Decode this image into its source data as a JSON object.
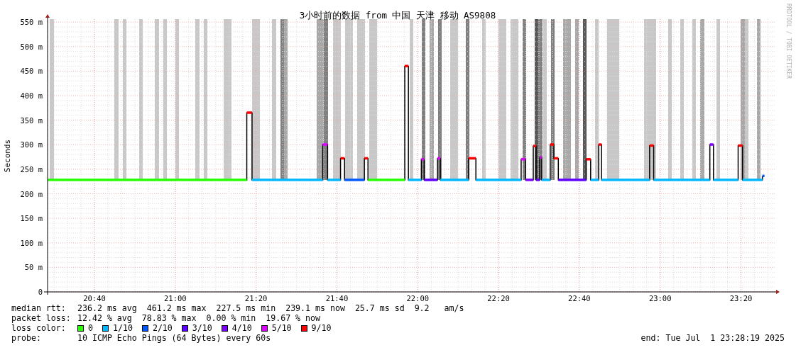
{
  "graph": {
    "title": "3小时前的数据 from 中国 天津 移动 AS9808",
    "side_text": "RRDTOOL / TOBI OETIKER",
    "chart_data": {
      "type": "line",
      "ylabel": "Seconds",
      "grid": true,
      "xlim": [
        1228.4,
        1408.7
      ],
      "ylim": [
        0,
        556
      ],
      "xticks": [
        {
          "value": 1240,
          "label": "20:40"
        },
        {
          "value": 1260,
          "label": "21:00"
        },
        {
          "value": 1280,
          "label": "21:20"
        },
        {
          "value": 1300,
          "label": "21:40"
        },
        {
          "value": 1320,
          "label": "22:00"
        },
        {
          "value": 1340,
          "label": "22:20"
        },
        {
          "value": 1360,
          "label": "22:40"
        },
        {
          "value": 1380,
          "label": "23:00"
        },
        {
          "value": 1400,
          "label": "23:20"
        }
      ],
      "yticks": [
        {
          "value": 0,
          "label": "0"
        },
        {
          "value": 50,
          "label": "50 m"
        },
        {
          "value": 100,
          "label": "100 m"
        },
        {
          "value": 150,
          "label": "150 m"
        },
        {
          "value": 200,
          "label": "200 m"
        },
        {
          "value": 250,
          "label": "250 m"
        },
        {
          "value": 300,
          "label": "300 m"
        },
        {
          "value": 350,
          "label": "350 m"
        },
        {
          "value": 400,
          "label": "400 m"
        },
        {
          "value": 450,
          "label": "450 m"
        },
        {
          "value": 500,
          "label": "500 m"
        },
        {
          "value": 550,
          "label": "550 m"
        }
      ],
      "x": [
        1228.5,
        1277.7,
        1277.7,
        1279.0,
        1279.0,
        1296.5,
        1296.5,
        1297.7,
        1297.7,
        1300.9,
        1300.9,
        1301.9,
        1301.9,
        1306.8,
        1306.8,
        1307.7,
        1307.7,
        1316.8,
        1316.8,
        1317.7,
        1317.7,
        1320.9,
        1320.9,
        1321.6,
        1321.6,
        1324.9,
        1324.9,
        1325.6,
        1325.6,
        1332.6,
        1332.6,
        1334.4,
        1334.4,
        1345.6,
        1345.6,
        1346.7,
        1346.7,
        1348.6,
        1348.6,
        1349.3,
        1349.3,
        1350.2,
        1350.2,
        1350.7,
        1350.7,
        1352.8,
        1352.8,
        1353.7,
        1353.7,
        1354.8,
        1354.8,
        1361.7,
        1361.7,
        1362.8,
        1362.8,
        1364.8,
        1364.8,
        1365.5,
        1365.5,
        1377.4,
        1377.4,
        1378.4,
        1378.4,
        1392.3,
        1392.3,
        1393.2,
        1393.2,
        1399.3,
        1399.3,
        1400.4,
        1400.4,
        1405.3,
        1405.3
      ],
      "series": [
        {
          "color": "#000000",
          "values": [
            228,
            228,
            365,
            365,
            228,
            228,
            300,
            300,
            228,
            228,
            272,
            272,
            228,
            228,
            272,
            272,
            228,
            228,
            460,
            460,
            228,
            228,
            270,
            270,
            228,
            228,
            272,
            272,
            228,
            228,
            272,
            272,
            228,
            228,
            270,
            270,
            228,
            228,
            297,
            297,
            228,
            228,
            274,
            274,
            228,
            228,
            300,
            300,
            272,
            272,
            228,
            228,
            270,
            270,
            228,
            228,
            300,
            300,
            228,
            228,
            298,
            298,
            228,
            228,
            300,
            300,
            228,
            228,
            298,
            298,
            228,
            228,
            236
          ]
        }
      ]
    },
    "loss_segments": [
      {
        "color": "#26ff00"
      },
      {
        "color": "#ff0000"
      },
      {
        "color": "#00b8ff"
      },
      {
        "color": "#dd00ff"
      },
      {
        "color": "#00b8ff"
      },
      {
        "color": "#ff0000"
      },
      {
        "color": "#0059ff"
      },
      {
        "color": "#ff0000"
      },
      {
        "color": "#26ff00"
      },
      {
        "color": "#ff0000"
      },
      {
        "color": "#00b8ff"
      },
      {
        "color": "#dd00ff"
      },
      {
        "color": "#5e00ff"
      },
      {
        "color": "#dd00ff"
      },
      {
        "color": "#00b8ff"
      },
      {
        "color": "#ff0000"
      },
      {
        "color": "#00b8ff"
      },
      {
        "color": "#dd00ff"
      },
      {
        "color": "#7e00ff"
      },
      {
        "color": "#ff0000"
      },
      {
        "color": "#5e00ff"
      },
      {
        "color": "#dd00ff"
      },
      {
        "color": "#00b8ff"
      },
      {
        "color": "#ff0000"
      },
      {
        "color": "#ff0000"
      },
      {
        "color": "#5e00ff"
      },
      {
        "color": "#ff0000"
      },
      {
        "color": "#00b8ff"
      },
      {
        "color": "#ff0000"
      },
      {
        "color": "#00b8ff"
      },
      {
        "color": "#ff0000"
      },
      {
        "color": "#00b8ff"
      },
      {
        "color": "#7e00ff"
      },
      {
        "color": "#00b8ff"
      },
      {
        "color": "#ff0000"
      },
      {
        "color": "#00b8ff"
      },
      {
        "color": "#0059ff"
      }
    ]
  },
  "stats": [
    {
      "label": "median rtt:",
      "text": "236.2 ms avg  461.2 ms max  227.5 ms min  239.1 ms now  25.7 ms sd  9.2   am/s"
    },
    {
      "label": "packet loss:",
      "text": "12.42 % avg  78.83 % max  0.00 % min  19.67 % now"
    }
  ],
  "loss_legend": {
    "label": "loss color:",
    "items": [
      {
        "label": "0",
        "color": "#26ff00"
      },
      {
        "label": "1/10",
        "color": "#00b8ff"
      },
      {
        "label": "2/10",
        "color": "#0059ff"
      },
      {
        "label": "3/10",
        "color": "#5e00ff"
      },
      {
        "label": "4/10",
        "color": "#7e00ff"
      },
      {
        "label": "5/10",
        "color": "#dd00ff"
      },
      {
        "label": "9/10",
        "color": "#ff0000"
      }
    ]
  },
  "probe": {
    "label": "probe:",
    "text": "10 ICMP Echo Pings (64 Bytes) every 60s"
  },
  "end": "end: Tue Jul  1 23:28:19 2025"
}
